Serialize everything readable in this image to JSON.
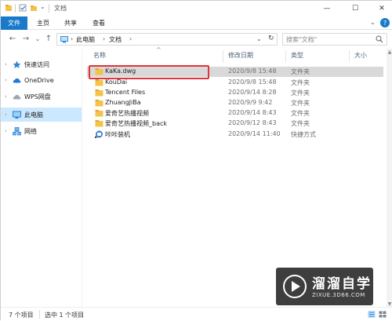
{
  "window": {
    "title": "文档",
    "controls": {
      "minimize": "—",
      "maximize": "☐",
      "close": "✕"
    }
  },
  "ribbon": {
    "tabs": [
      {
        "label": "文件",
        "active": true
      },
      {
        "label": "主页"
      },
      {
        "label": "共享"
      },
      {
        "label": "查看"
      }
    ],
    "collapse_glyph": "⌄",
    "help_glyph": "?"
  },
  "address": {
    "breadcrumbs": [
      "此电脑",
      "文档"
    ],
    "separator": "›",
    "dropdown_glyph": "⌄",
    "refresh_glyph": "↻",
    "search_placeholder": "搜索\"文档\""
  },
  "navigation": {
    "back": "←",
    "forward": "→",
    "recent": "⌄",
    "up": "↑"
  },
  "sidebar": {
    "items": [
      {
        "label": "快速访问",
        "icon": "star-icon",
        "arrow": "›"
      },
      {
        "label": "OneDrive",
        "icon": "cloud-icon",
        "arrow": "›"
      },
      {
        "label": "WPS网盘",
        "icon": "cloud-drive-icon",
        "arrow": "›"
      },
      {
        "label": "此电脑",
        "icon": "computer-icon",
        "arrow": "›",
        "selected": true
      },
      {
        "label": "网络",
        "icon": "network-icon",
        "arrow": "›"
      }
    ]
  },
  "file_list": {
    "columns": [
      "名称",
      "修改日期",
      "类型",
      "大小"
    ],
    "sort_indicator": "^",
    "rows": [
      {
        "name": "KaKa.dwg",
        "date": "2020/9/8 15:48",
        "type": "文件夹",
        "icon": "folder-icon",
        "selected": true
      },
      {
        "name": "KouDai",
        "date": "2020/9/8 15:48",
        "type": "文件夹",
        "icon": "folder-icon"
      },
      {
        "name": "Tencent Files",
        "date": "2020/9/14 8:28",
        "type": "文件夹",
        "icon": "folder-icon"
      },
      {
        "name": "ZhuangJiBa",
        "date": "2020/9/9 9:42",
        "type": "文件夹",
        "icon": "folder-icon"
      },
      {
        "name": "爱奇艺热播视频",
        "date": "2020/9/14 8:43",
        "type": "文件夹",
        "icon": "folder-icon"
      },
      {
        "name": "爱奇艺热播视频_back",
        "date": "2020/9/12 8:43",
        "type": "文件夹",
        "icon": "folder-icon"
      },
      {
        "name": "咔咔装机",
        "date": "2020/9/14 11:40",
        "type": "快捷方式",
        "icon": "shortcut-icon"
      }
    ]
  },
  "status_bar": {
    "item_count": "7 个项目",
    "selection": "选中 1 个项目"
  },
  "watermark": {
    "title": "溜溜自学",
    "url": "ZIXUE.3D66.COM"
  },
  "colors": {
    "accent": "#1979ca",
    "selection": "#cce8ff",
    "highlight_box": "#e0343a",
    "folder": "#f3c34a"
  }
}
